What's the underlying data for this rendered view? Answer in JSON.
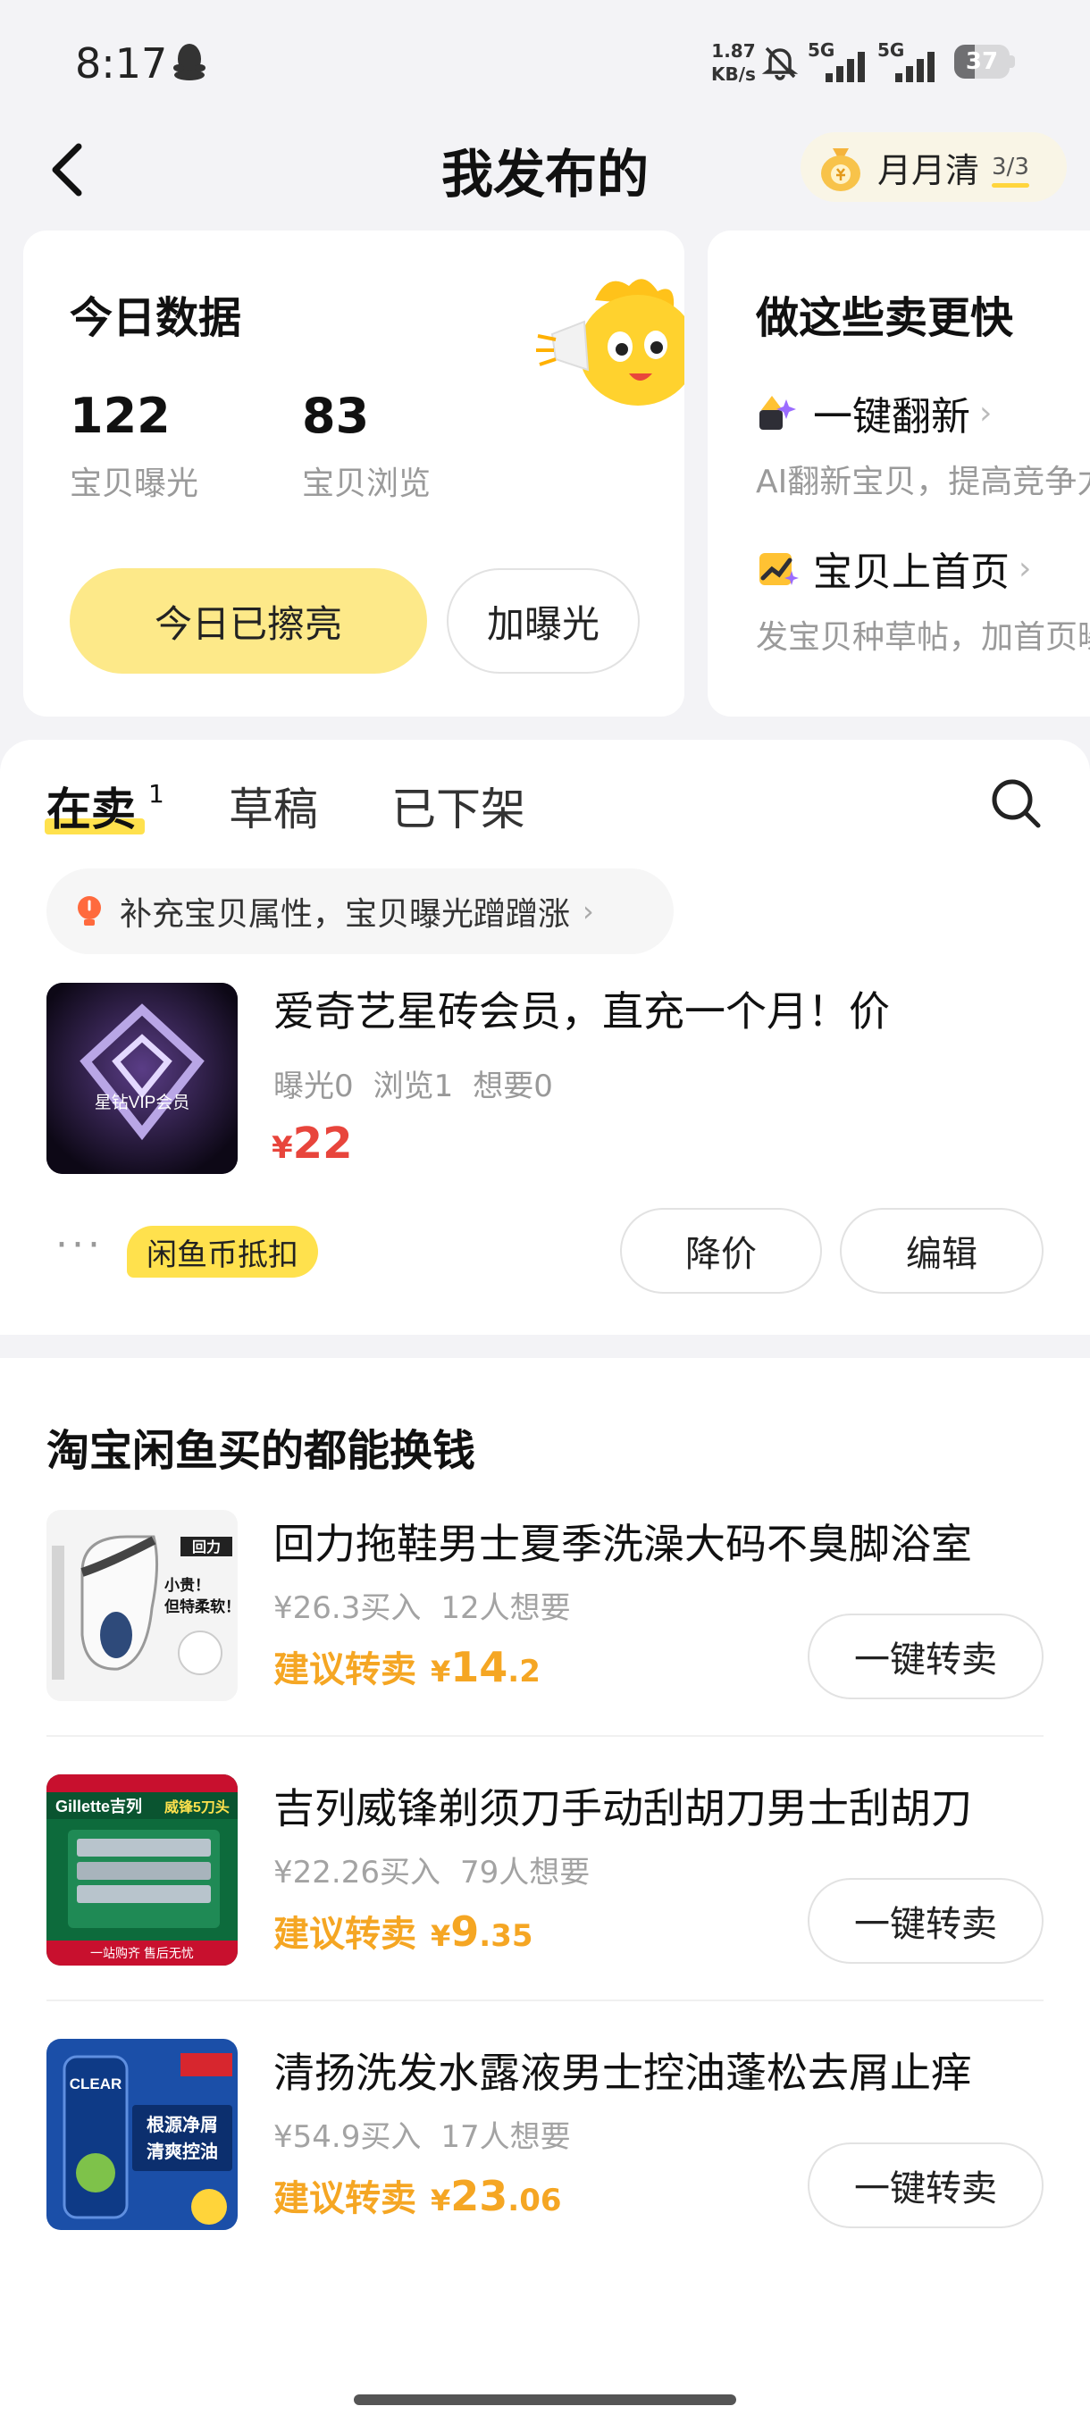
{
  "status_bar": {
    "time": "8:17",
    "net_speed_value": "1.87",
    "net_speed_unit": "KB/s",
    "sim1_label": "5G",
    "sim2_label": "5G",
    "battery": "37",
    "battery_level": 0.37
  },
  "nav": {
    "title": "我发布的",
    "monthly_label": "月月清",
    "monthly_count": "3/3"
  },
  "today": {
    "title": "今日数据",
    "exposure_value": "122",
    "exposure_label": "宝贝曝光",
    "views_value": "83",
    "views_label": "宝贝浏览",
    "polished_button": "今日已擦亮",
    "boost_button": "加曝光"
  },
  "faster": {
    "title": "做这些卖更快",
    "tips": [
      {
        "title": "一键翻新",
        "desc": "AI翻新宝贝，提高竞争力"
      },
      {
        "title": "宝贝上首页",
        "desc": "发宝贝种草帖，加首页曝光"
      }
    ]
  },
  "tabs": {
    "on_sale": "在卖",
    "on_sale_count": "1",
    "drafts": "草稿",
    "removed": "已下架"
  },
  "hint": {
    "text": "补充宝贝属性，宝贝曝光蹭蹭涨"
  },
  "listing": {
    "thumb_text": "星钻VIP会员",
    "title": "爱奇艺星砖会员，直充一个月！价",
    "exposure": "曝光0",
    "views": "浏览1",
    "wants": "想要0",
    "currency": "¥",
    "price": "22",
    "more": "···",
    "coin_tag": "闲鱼币抵扣",
    "reduce_button": "降价",
    "edit_button": "编辑"
  },
  "resell": {
    "heading": "淘宝闲鱼买的都能换钱",
    "suggest_label": "建议转卖",
    "button_label": "一键转卖",
    "currency": "¥",
    "items": [
      {
        "title": "回力拖鞋男士夏季洗澡大码不臭脚浴室",
        "bought": "¥26.3买入",
        "wants": "12人想要",
        "price_int": "14",
        "price_dec": ".2",
        "thumb_brand": "回力",
        "thumb_text1": "小贵！",
        "thumb_text2": "但特柔软！"
      },
      {
        "title": "吉列威锋剃须刀手动刮胡刀男士刮胡刀",
        "bought": "¥22.26买入",
        "wants": "79人想要",
        "price_int": "9",
        "price_dec": ".35",
        "thumb_brand": "Gillette吉列",
        "thumb_text1": "威锋5刀头",
        "thumb_text2": "一站购齐 售后无忧"
      },
      {
        "title": "清扬洗发水露液男士控油蓬松去屑止痒",
        "bought": "¥54.9买入",
        "wants": "17人想要",
        "price_int": "23",
        "price_dec": ".06",
        "thumb_brand": "CLEAR",
        "thumb_text1": "根源净屑",
        "thumb_text2": "清爽控油"
      }
    ]
  }
}
